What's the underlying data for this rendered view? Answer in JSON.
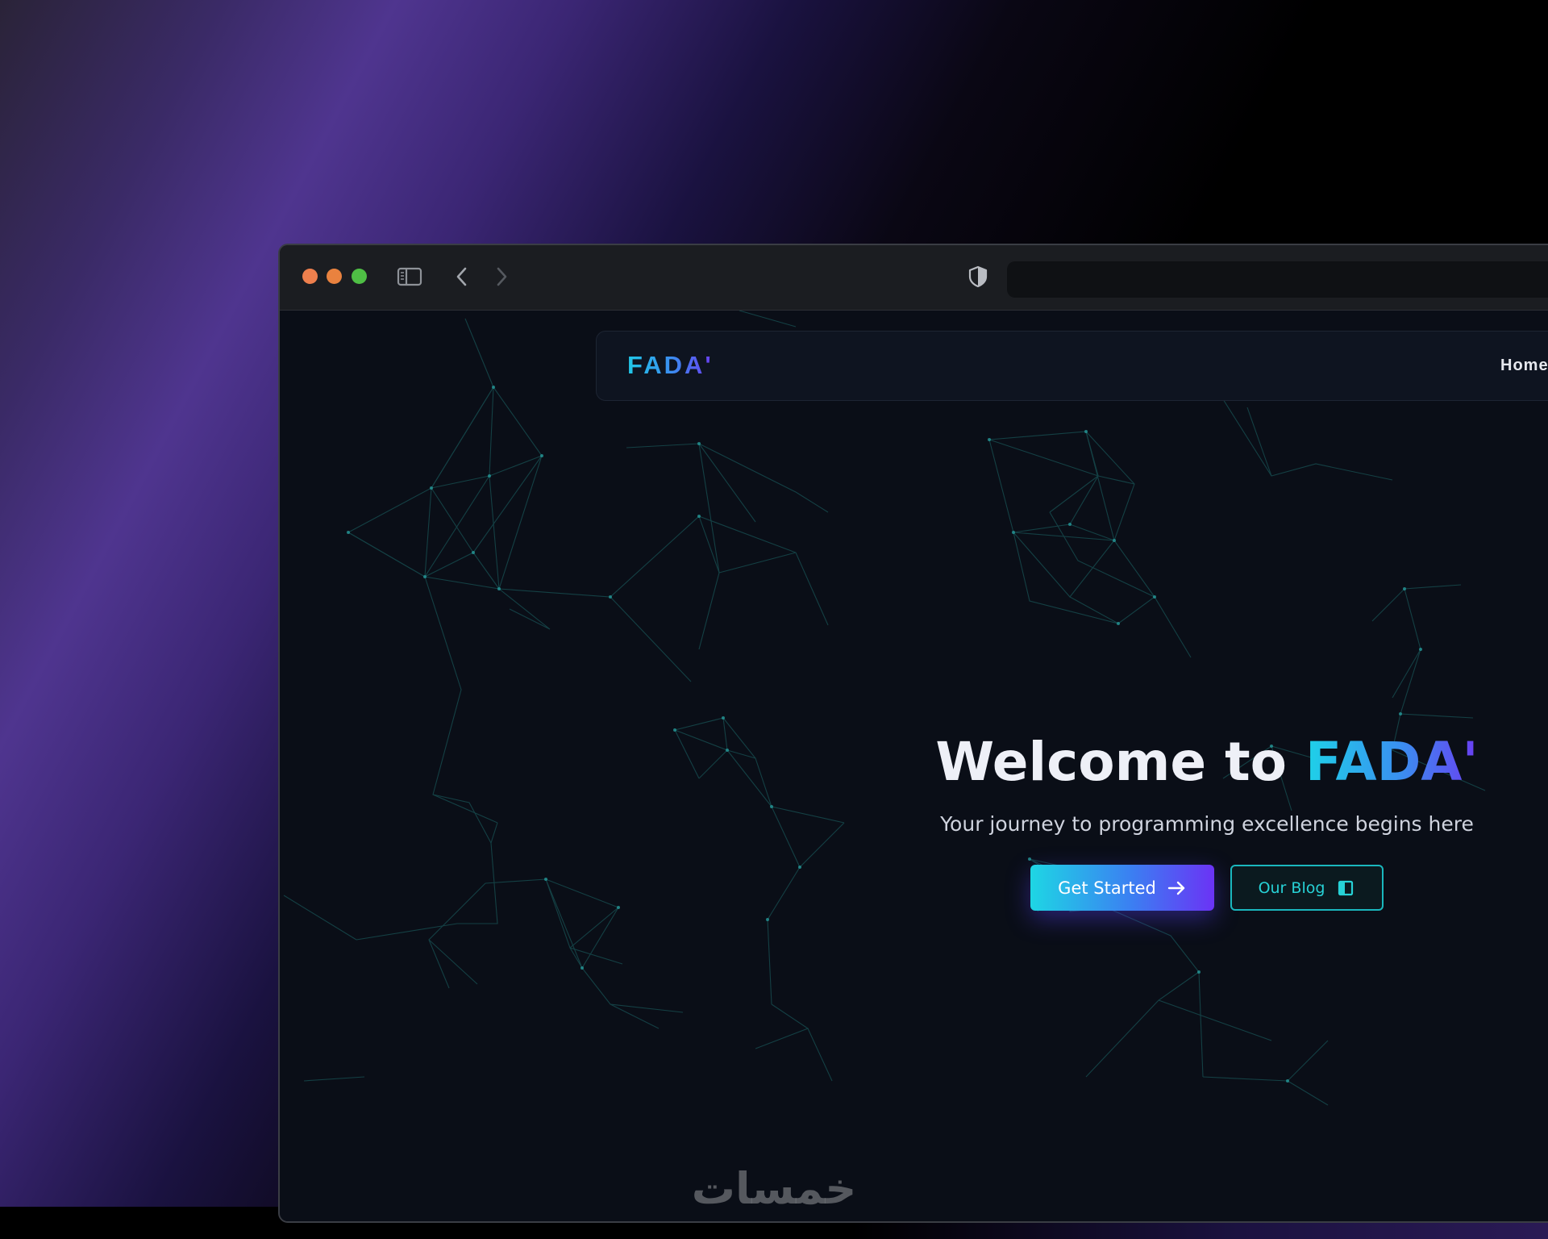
{
  "site": {
    "brand": "FADA'",
    "nav": {
      "home": "Home"
    }
  },
  "hero": {
    "title_prefix": "Welcome to ",
    "title_accent": "FADA'",
    "subtitle": "Your journey to programming excellence begins here"
  },
  "buttons": {
    "get_started": "Get Started",
    "our_blog": "Our Blog"
  },
  "icons": {
    "sidebar": "sidebar-toggle-icon",
    "back": "chevron-left-icon",
    "forward": "chevron-right-icon",
    "shield": "shield-icon",
    "arrow": "arrow-right-icon",
    "book": "book-icon"
  },
  "colors": {
    "accent_cyan": "#1ed6e4",
    "accent_blue": "#3b7ff2",
    "accent_purple": "#6b33f5",
    "page_bg": "#0a0e17",
    "outline_teal": "#1ab7bd"
  },
  "watermark": "خمسات"
}
